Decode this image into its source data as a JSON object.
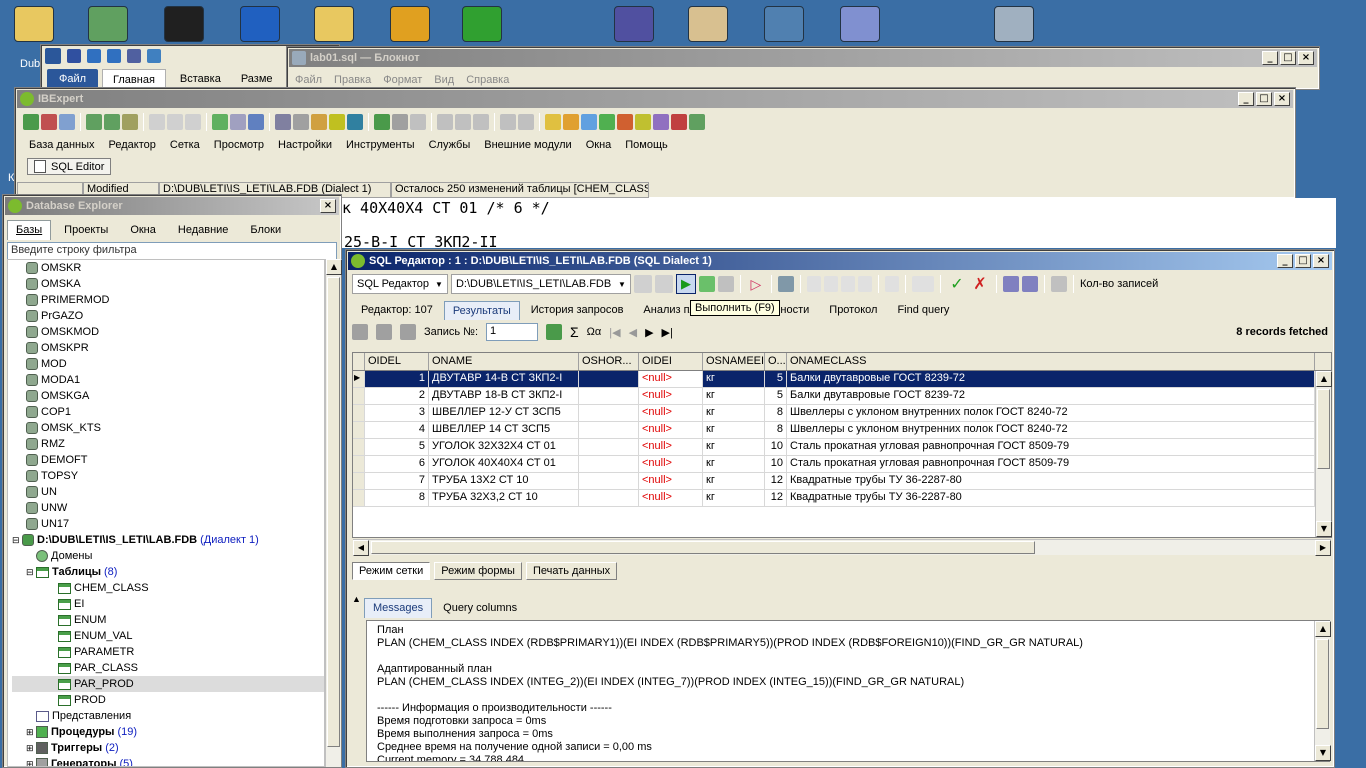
{
  "desktop": {
    "icons": [
      {
        "name": "folder-icon",
        "label": "Dub",
        "color": "#e8c860"
      },
      {
        "name": "tools-icon",
        "label": "",
        "color": "#60a060"
      },
      {
        "name": "7zip-icon",
        "label": "",
        "color": "#202020"
      },
      {
        "name": "info-icon",
        "label": "",
        "color": "#2060c0"
      },
      {
        "name": "folder2-icon",
        "label": "",
        "color": "#e8c860"
      },
      {
        "name": "app-icon",
        "label": "",
        "color": "#e0a020"
      },
      {
        "name": "globe-icon",
        "label": "",
        "color": "#30a030"
      },
      {
        "name": "vs-icon",
        "label": "",
        "color": "#5050a0"
      },
      {
        "name": "mail-icon",
        "label": "",
        "color": "#d8c090"
      },
      {
        "name": "network-icon",
        "label": "",
        "color": "#5080b0"
      },
      {
        "name": "notepad-icon",
        "label": "",
        "color": "#8090d0"
      },
      {
        "name": "calc-icon",
        "label": "",
        "color": "#a0b0c0"
      }
    ],
    "left_letter": "К"
  },
  "word": {
    "tab_file": "Файл",
    "tab_home": "Главная",
    "tab_insert": "Вставка",
    "tab_layout": "Разме"
  },
  "notepad": {
    "title": "lab01.sql — Блокнот",
    "menu": [
      "Файл",
      "Правка",
      "Формат",
      "Вид",
      "Справка"
    ]
  },
  "ibexpert": {
    "title": "IBExpert",
    "menu": [
      "База данных",
      "Редактор",
      "Сетка",
      "Просмотр",
      "Настройки",
      "Инструменты",
      "Службы",
      "Внешние модули",
      "Окна",
      "Помощь"
    ],
    "task_tab": "SQL Editor",
    "status_modified": "Modified",
    "status_path": "D:\\DUB\\LETI\\IS_LETI\\LAB.FDB (Dialect 1)",
    "status_changes": "Осталось 250 изменений таблицы [CHEM_CLASS]"
  },
  "background_sql": {
    "line1": "к 40Х40Х4 СТ 01 /* 6 */",
    "line2": "25-В-I СТ 3КП2-II"
  },
  "explorer": {
    "title": "Database Explorer",
    "tabs": [
      "Базы",
      "Проекты",
      "Окна",
      "Недавние",
      "Блоки"
    ],
    "filter_placeholder": "Введите строку фильтра",
    "dbs": [
      "OMSKR",
      "OMSKA",
      "PRIMERMOD",
      "PrGAZO",
      "OMSKMOD",
      "OMSKPR",
      "MOD",
      "MODA1",
      "OMSKGA",
      "COP1",
      "OMSK_KTS",
      "RMZ",
      "DEMOFT",
      "TOPSY",
      "UN",
      "UNW",
      "UN17"
    ],
    "active_db": "D:\\DUB\\LETI\\IS_LETI\\LAB.FDB",
    "active_db_dialect": "(Диалект 1)",
    "domains": "Домены",
    "tables_label": "Таблицы",
    "tables_count": "(8)",
    "tables": [
      "CHEM_CLASS",
      "EI",
      "ENUM",
      "ENUM_VAL",
      "PARAMETR",
      "PAR_CLASS",
      "PAR_PROD",
      "PROD"
    ],
    "views": "Представления",
    "procedures": "Процедуры",
    "procedures_count": "(19)",
    "triggers": "Триггеры",
    "triggers_count": "(2)",
    "generators": "Генераторы",
    "generators_count": "(5)"
  },
  "sql_editor": {
    "title": "SQL Редактор : 1 : D:\\DUB\\LETI\\IS_LETI\\LAB.FDB (SQL Dialect 1)",
    "editor_dropdown": "SQL Редактор",
    "db_dropdown": "D:\\DUB\\LETI\\IS_LETI\\LAB.FDB",
    "records_label": "Кол-во записей",
    "tooltip": "Выполнить (F9)",
    "tabs": [
      "Редактор: 107",
      "Результаты",
      "История запросов",
      "Анализ пл",
      "роизводительности",
      "Протокол",
      "Find query"
    ],
    "record_label": "Запись №:",
    "record_value": "1",
    "fetched": "8 records fetched",
    "columns": [
      "OIDEL",
      "ONAME",
      "OSHOR...",
      "OIDEI",
      "OSNAMEEI",
      "O...",
      "ONAMECLASS"
    ],
    "rows": [
      {
        "oidel": "1",
        "oname": "ДВУТАВР 14-В СТ ЗКП2-I",
        "oshort": "",
        "oidei": "<null>",
        "osname": "кг",
        "o": "5",
        "class": "Балки двутавровые ГОСТ 8239-72"
      },
      {
        "oidel": "2",
        "oname": "ДВУТАВР 18-В СТ ЗКП2-I",
        "oshort": "",
        "oidei": "<null>",
        "osname": "кг",
        "o": "5",
        "class": "Балки двутавровые ГОСТ 8239-72"
      },
      {
        "oidel": "3",
        "oname": "ШВЕЛЛЕР 12-У СТ ЗСП5",
        "oshort": "",
        "oidei": "<null>",
        "osname": "кг",
        "o": "8",
        "class": "Швеллеры с уклоном внутренних полок ГОСТ 8240-72"
      },
      {
        "oidel": "4",
        "oname": "ШВЕЛЛЕР 14 СТ ЗСП5",
        "oshort": "",
        "oidei": "<null>",
        "osname": "кг",
        "o": "8",
        "class": "Швеллеры с уклоном внутренних полок ГОСТ 8240-72"
      },
      {
        "oidel": "5",
        "oname": "УГОЛОК 32Х32Х4 СТ 01",
        "oshort": "",
        "oidei": "<null>",
        "osname": "кг",
        "o": "10",
        "class": "Сталь прокатная угловая равнопрочная ГОСТ 8509-79"
      },
      {
        "oidel": "6",
        "oname": "УГОЛОК 40Х40Х4 СТ 01",
        "oshort": "",
        "oidei": "<null>",
        "osname": "кг",
        "o": "10",
        "class": "Сталь прокатная угловая равнопрочная ГОСТ 8509-79"
      },
      {
        "oidel": "7",
        "oname": "ТРУБА 13Х2 СТ 10",
        "oshort": "",
        "oidei": "<null>",
        "osname": "кг",
        "o": "12",
        "class": "Квадратные трубы ТУ 36-2287-80"
      },
      {
        "oidel": "8",
        "oname": "ТРУБА 32Х3,2 СТ 10",
        "oshort": "",
        "oidei": "<null>",
        "osname": "кг",
        "o": "12",
        "class": "Квадратные трубы ТУ 36-2287-80"
      }
    ],
    "view_tabs": [
      "Режим сетки",
      "Режим формы",
      "Печать данных"
    ],
    "msg_tabs": [
      "Messages",
      "Query columns"
    ],
    "messages": [
      "План",
      "PLAN (CHEM_CLASS INDEX (RDB$PRIMARY1))(EI INDEX (RDB$PRIMARY5))(PROD INDEX (RDB$FOREIGN10))(FIND_GR_GR NATURAL)",
      "",
      "Адаптированный план",
      "PLAN (CHEM_CLASS INDEX (INTEG_2))(EI INDEX (INTEG_7))(PROD INDEX (INTEG_15))(FIND_GR_GR NATURAL)",
      "",
      "------ Информация о производительности ------",
      "Время подготовки запроса = 0ms",
      "Время выполнения запроса = 0ms",
      "Среднее время на получение одной записи = 0,00 ms",
      "Current memory = 34 788 484"
    ]
  }
}
